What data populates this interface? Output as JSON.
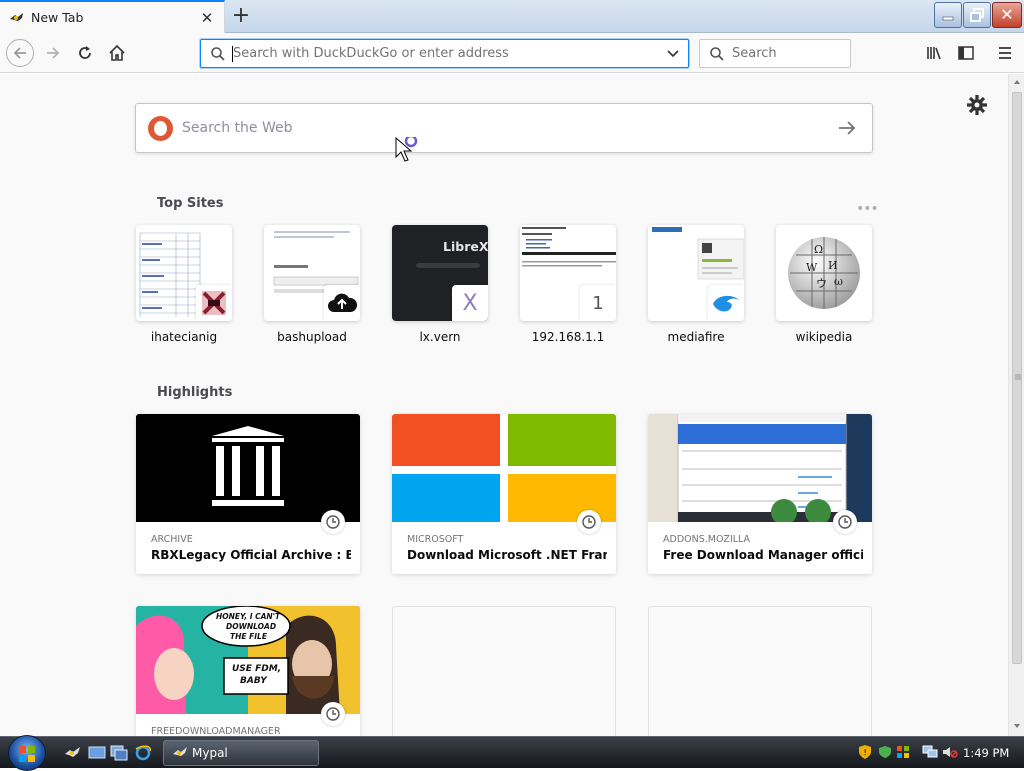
{
  "tab": {
    "title": "New Tab"
  },
  "urlbar": {
    "placeholder": "Search with DuckDuckGo or enter address"
  },
  "searchbar": {
    "placeholder": "Search"
  },
  "websearch": {
    "placeholder": "Search the Web"
  },
  "top_sites": {
    "heading": "Top Sites",
    "items": [
      {
        "label": "ihatecianig"
      },
      {
        "label": "bashupload"
      },
      {
        "label": "lx.vern",
        "thumb_text": "LibreX"
      },
      {
        "label": "192.168.1.1",
        "badge_text": "1"
      },
      {
        "label": "mediafire"
      },
      {
        "label": "wikipedia"
      }
    ]
  },
  "highlights": {
    "heading": "Highlights",
    "cards": [
      {
        "source": "ARCHIVE",
        "title": "RBXLegacy Official Archive : Bitl..."
      },
      {
        "source": "MICROSOFT",
        "title": "Download Microsoft .NET Frame..."
      },
      {
        "source": "ADDONS.MOZILLA",
        "title": "Free Download Manager official ..."
      },
      {
        "source": "FREEDOWNLOADMANAGER",
        "title": "",
        "comic_line1": "HONEY, I CAN'T",
        "comic_line2": "DOWNLOAD",
        "comic_line3": "THE FILE",
        "comic_line4": "USE FDM,",
        "comic_line5": "BABY"
      }
    ]
  },
  "taskbar": {
    "task_label": "Mypal",
    "time": "1:49 PM"
  },
  "colors": {
    "accent": "#0a84ff",
    "ddg": "#de5833"
  }
}
